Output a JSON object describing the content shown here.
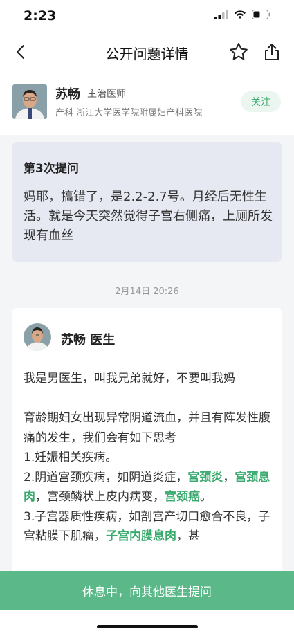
{
  "status": {
    "time": "2:23"
  },
  "nav": {
    "title": "公开问题详情"
  },
  "doctor": {
    "name": "苏畅",
    "title": "主治医师",
    "hospital": "产科 浙江大学医学院附属妇产科医院",
    "follow_label": "关注"
  },
  "question": {
    "heading": "第3次提问",
    "text": "妈耶，搞错了，是2.2-2.7号。月经后无性生活。就是今天突然觉得子宫右侧痛，上厕所发现有血丝"
  },
  "timestamp": "2月14日 20:26",
  "answer": {
    "author": "苏畅 医生",
    "intro": "我是男医生，叫我兄弟就好，不要叫我妈",
    "line1": "育龄期妇女出现异常阴道流血，并且有阵发性腹痛的发生，我们会有如下思考",
    "item1": "1.妊娠相关疾病。",
    "item2_a": "2.阴道宫颈疾病，如阴道炎症，",
    "item2_hl1": "宫颈炎",
    "item2_b": "，",
    "item2_hl2": "宫颈息肉",
    "item2_c": "，宫颈鳞状上皮内病变，",
    "item2_hl3": "宫颈癌",
    "item2_d": "。",
    "item3_a": "3.子宫器质性疾病，如剖宫产切口愈合不良，子宫粘膜下肌瘤，",
    "item3_hl1": "子宫内膜息肉",
    "item3_b": "，甚"
  },
  "bottom": {
    "label": "休息中，向其他医生提问"
  },
  "colors": {
    "accent_green": "#3aaa6e",
    "bottom_bar": "#5bb888",
    "question_bg": "#e6e9f2"
  }
}
